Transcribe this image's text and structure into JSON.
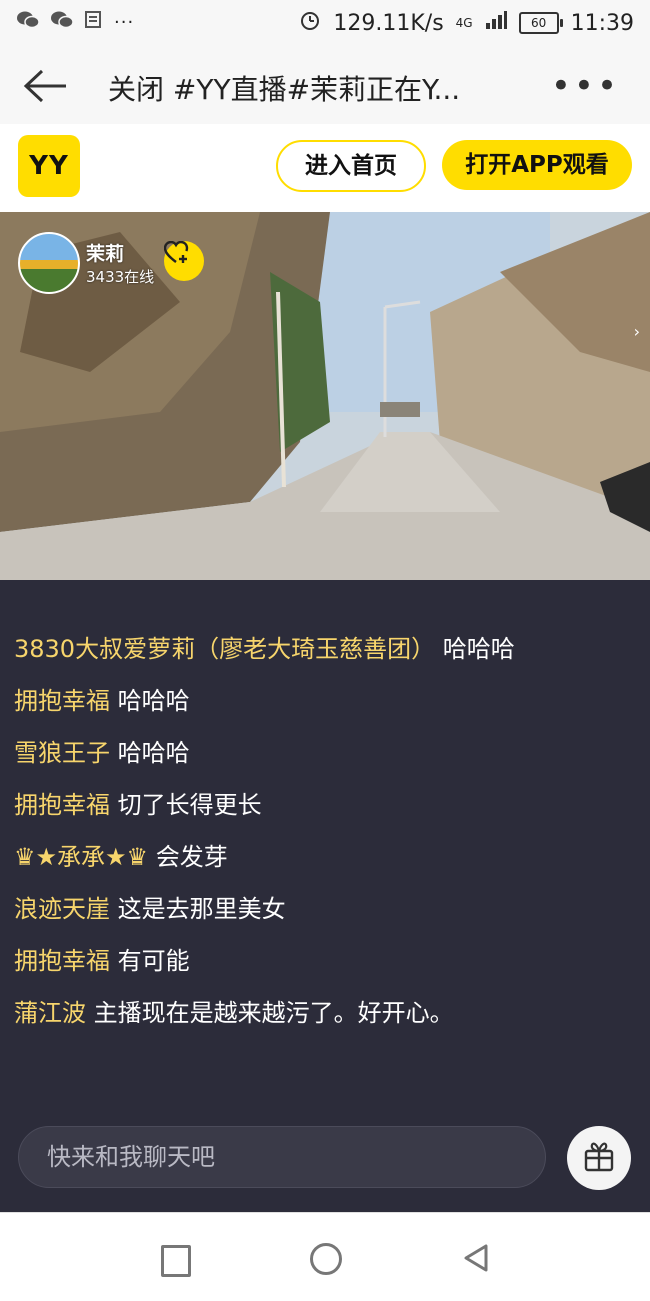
{
  "status_bar": {
    "left_icons": [
      "wechat-icon",
      "wechat-icon",
      "notification-icon"
    ],
    "more_dots": "···",
    "speed": "129.11K/s",
    "network": "4G",
    "battery": "60",
    "time": "11:39"
  },
  "header": {
    "title": "关闭 #YY直播#茉莉正在Y..."
  },
  "yy_bar": {
    "logo_text": "YY",
    "home_button": "进入首页",
    "app_button": "打开APP观看"
  },
  "streamer": {
    "name": "茉莉",
    "online": "3433在线"
  },
  "chat": {
    "messages": [
      {
        "user": "3830大叔爱萝莉（廖老大琦玉慈善团）",
        "text": "哈哈哈"
      },
      {
        "user": "拥抱幸福",
        "text": "哈哈哈"
      },
      {
        "user": "雪狼王子",
        "text": "哈哈哈"
      },
      {
        "user": "拥抱幸福",
        "text": "切了长得更长"
      },
      {
        "user": "♛★承承★♛",
        "text": "会发芽"
      },
      {
        "user": "浪迹天崖",
        "text": "这是去那里美女"
      },
      {
        "user": "拥抱幸福",
        "text": "有可能"
      },
      {
        "user": "蒲江波",
        "text": "主播现在是越来越污了。好开心。"
      }
    ],
    "input_placeholder": "快来和我聊天吧"
  },
  "colors": {
    "brand_yellow": "#ffdd00",
    "chat_bg": "#2c2c3a",
    "username": "#f7d56c"
  }
}
